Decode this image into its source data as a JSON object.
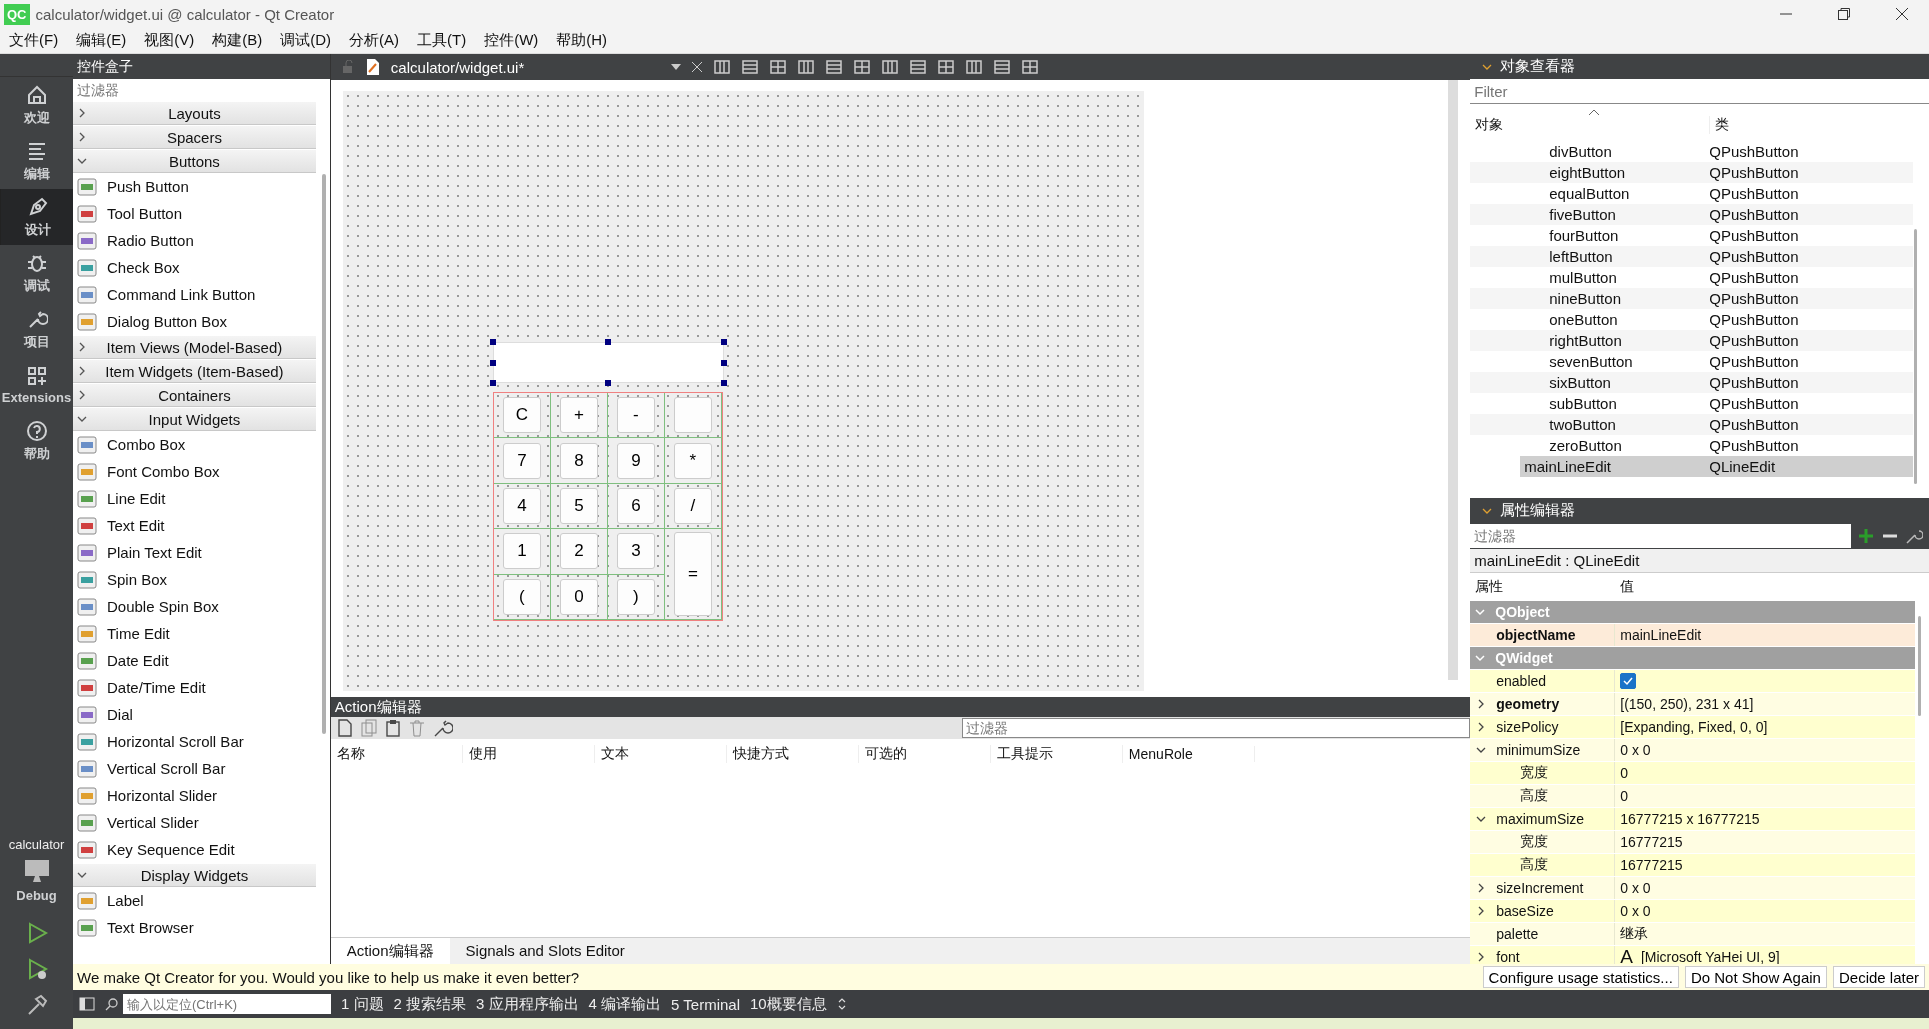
{
  "window": {
    "logo": "QC",
    "title": "calculator/widget.ui @ calculator - Qt Creator"
  },
  "menu": [
    "文件(F)",
    "编辑(E)",
    "视图(V)",
    "构建(B)",
    "调试(D)",
    "分析(A)",
    "工具(T)",
    "控件(W)",
    "帮助(H)"
  ],
  "modes": [
    {
      "label": "欢迎",
      "kind": "home",
      "selected": false
    },
    {
      "label": "编辑",
      "kind": "edit",
      "selected": false
    },
    {
      "label": "设计",
      "kind": "design",
      "selected": true
    },
    {
      "label": "调试",
      "kind": "debug",
      "selected": false
    },
    {
      "label": "项目",
      "kind": "projects",
      "selected": false
    },
    {
      "label": "Extensions",
      "kind": "extensions",
      "selected": false
    },
    {
      "label": "帮助",
      "kind": "help",
      "selected": false
    }
  ],
  "target": {
    "project": "calculator",
    "config": "Debug"
  },
  "widget_box": {
    "title": "控件盒子",
    "filter_placeholder": "过滤器",
    "categories": [
      {
        "label": "Layouts",
        "expanded": false
      },
      {
        "label": "Spacers",
        "expanded": false
      },
      {
        "label": "Buttons",
        "expanded": true,
        "items": [
          {
            "label": "Push Button"
          },
          {
            "label": "Tool Button"
          },
          {
            "label": "Radio Button"
          },
          {
            "label": "Check Box"
          },
          {
            "label": "Command Link Button"
          },
          {
            "label": "Dialog Button Box"
          }
        ]
      },
      {
        "label": "Item Views (Model-Based)",
        "expanded": false
      },
      {
        "label": "Item Widgets (Item-Based)",
        "expanded": false
      },
      {
        "label": "Containers",
        "expanded": false
      },
      {
        "label": "Input Widgets",
        "expanded": true,
        "items": [
          {
            "label": "Combo Box"
          },
          {
            "label": "Font Combo Box"
          },
          {
            "label": "Line Edit"
          },
          {
            "label": "Text Edit"
          },
          {
            "label": "Plain Text Edit"
          },
          {
            "label": "Spin Box"
          },
          {
            "label": "Double Spin Box"
          },
          {
            "label": "Time Edit"
          },
          {
            "label": "Date Edit"
          },
          {
            "label": "Date/Time Edit"
          },
          {
            "label": "Dial"
          },
          {
            "label": "Horizontal Scroll Bar"
          },
          {
            "label": "Vertical Scroll Bar"
          },
          {
            "label": "Horizontal Slider"
          },
          {
            "label": "Vertical Slider"
          },
          {
            "label": "Key Sequence Edit"
          }
        ]
      },
      {
        "label": "Display Widgets",
        "expanded": true,
        "items": [
          {
            "label": "Label"
          },
          {
            "label": "Text Browser"
          }
        ]
      }
    ]
  },
  "editor": {
    "file": "calculator/widget.ui*"
  },
  "form": {
    "keys": [
      {
        "kind": "key",
        "label": "C"
      },
      {
        "kind": "key",
        "label": "+"
      },
      {
        "kind": "key",
        "label": "-"
      },
      {
        "kind": "key"
      },
      {
        "kind": "key",
        "label": "7"
      },
      {
        "kind": "key",
        "label": "8"
      },
      {
        "kind": "key",
        "label": "9"
      },
      {
        "kind": "key",
        "label": "*"
      },
      {
        "kind": "key",
        "label": "4"
      },
      {
        "kind": "key",
        "label": "5"
      },
      {
        "kind": "key",
        "label": "6"
      },
      {
        "kind": "key",
        "label": "/"
      },
      {
        "kind": "key",
        "label": "1"
      },
      {
        "kind": "key",
        "label": "2"
      },
      {
        "kind": "key",
        "label": "3"
      },
      {
        "kind": "tall",
        "label": "="
      },
      {
        "kind": "key",
        "label": "("
      },
      {
        "kind": "key",
        "label": "0"
      },
      {
        "kind": "key",
        "label": ")"
      }
    ]
  },
  "action_editor": {
    "title": "Action编辑器",
    "filter_placeholder": "过滤器",
    "columns": [
      "名称",
      "使用",
      "文本",
      "快捷方式",
      "可选的",
      "工具提示",
      "MenuRole"
    ],
    "tabs": [
      {
        "label": "Action编辑器",
        "selected": true
      },
      {
        "label": "Signals and Slots Editor",
        "selected": false
      }
    ]
  },
  "object_inspector": {
    "title": "对象查看器",
    "filter_placeholder": "Filter",
    "columns": [
      "对象",
      "类"
    ],
    "rows": [
      {
        "children": [
          {
            "name": "divButton",
            "class": "QPushButton",
            "selected": false
          },
          {
            "name": "eightButton",
            "class": "QPushButton",
            "selected": false
          },
          {
            "name": "equalButton",
            "class": "QPushButton",
            "selected": false
          },
          {
            "name": "fiveButton",
            "class": "QPushButton",
            "selected": false
          },
          {
            "name": "fourButton",
            "class": "QPushButton",
            "selected": false
          },
          {
            "name": "leftButton",
            "class": "QPushButton",
            "selected": false
          },
          {
            "name": "mulButton",
            "class": "QPushButton",
            "selected": false
          },
          {
            "name": "nineButton",
            "class": "QPushButton",
            "selected": false
          },
          {
            "name": "oneButton",
            "class": "QPushButton",
            "selected": false
          },
          {
            "name": "rightButton",
            "class": "QPushButton",
            "selected": false
          },
          {
            "name": "sevenButton",
            "class": "QPushButton",
            "selected": false
          },
          {
            "name": "sixButton",
            "class": "QPushButton",
            "selected": false
          },
          {
            "name": "subButton",
            "class": "QPushButton",
            "selected": false
          },
          {
            "name": "twoButton",
            "class": "QPushButton",
            "selected": false
          },
          {
            "name": "zeroButton",
            "class": "QPushButton",
            "selected": false
          }
        ]
      },
      {
        "name": "mainLineEdit",
        "class": "QLineEdit",
        "selected": true
      }
    ]
  },
  "property_editor": {
    "title": "属性编辑器",
    "filter_placeholder": "过滤器",
    "object": "mainLineEdit : QLineEdit",
    "columns": [
      "属性",
      "值"
    ]
  },
  "properties": [
    {
      "name": "QObject",
      "expanded": true,
      "children": [
        {
          "kind": "text",
          "name": "objectName",
          "value": "mainLineEdit",
          "bold": true
        }
      ]
    },
    {
      "name": "QWidget",
      "expanded": true,
      "children": [
        {
          "kind": "checkbox",
          "name": "enabled",
          "checked": true,
          "bold": false
        },
        {
          "kind": "text",
          "name": "geometry",
          "value": "[(150, 250), 231 x 41]",
          "bold": true,
          "expanded": false
        },
        {
          "kind": "text",
          "name": "sizePolicy",
          "value": "[Expanding, Fixed, 0, 0]",
          "bold": false,
          "expanded": false
        },
        {
          "kind": "text",
          "name": "minimumSize",
          "value": "0 x 0",
          "bold": false,
          "expanded": true,
          "children": [
            {
              "kind": "text",
              "name": "宽度",
              "value": "0",
              "bold": false
            },
            {
              "kind": "text",
              "name": "高度",
              "value": "0",
              "bold": false
            }
          ]
        },
        {
          "kind": "text",
          "name": "maximumSize",
          "value": "16777215 x 16777215",
          "bold": false,
          "expanded": true,
          "children": [
            {
              "kind": "text",
              "name": "宽度",
              "value": "16777215",
              "bold": false
            },
            {
              "kind": "text",
              "name": "高度",
              "value": "16777215",
              "bold": false
            }
          ]
        },
        {
          "kind": "text",
          "name": "sizeIncrement",
          "value": "0 x 0",
          "bold": false,
          "expanded": false
        },
        {
          "kind": "text",
          "name": "baseSize",
          "value": "0 x 0",
          "bold": false,
          "expanded": false
        },
        {
          "kind": "text",
          "name": "palette",
          "value": "继承",
          "bold": false
        },
        {
          "kind": "font",
          "name": "font",
          "sample": "A",
          "value": "[Microsoft YaHei UI, 9]",
          "bold": false,
          "expanded": false
        }
      ]
    }
  ],
  "notification": {
    "message": "We make Qt Creator for you. Would you like to help us make it even better?",
    "buttons": [
      "Configure usage statistics...",
      "Do Not Show Again",
      "Decide later"
    ]
  },
  "status_bar": {
    "locator_placeholder": "输入以定位(Ctrl+K)",
    "panes": [
      "1 问题",
      "2 搜索结果",
      "3 应用程序输出",
      "4 编译输出",
      "5 Terminal",
      "10概要信息"
    ]
  }
}
